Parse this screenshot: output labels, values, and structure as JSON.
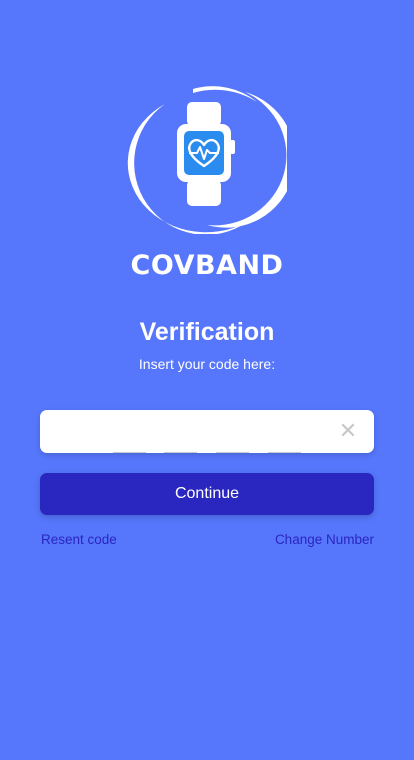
{
  "brand": {
    "name": "COVBAND",
    "logo_icon": "smartwatch-heart-icon"
  },
  "verification": {
    "title": "Verification",
    "subtitle": "Insert your code here:",
    "code_digits": [
      "",
      "",
      "",
      ""
    ],
    "clear_icon": "close-icon"
  },
  "actions": {
    "continue_label": "Continue",
    "resend_label": "Resent code",
    "change_number_label": "Change Number"
  },
  "colors": {
    "background": "#5676fb",
    "primary": "#2a26c0",
    "input_bg": "#ffffff",
    "text_light": "#ffffff"
  }
}
